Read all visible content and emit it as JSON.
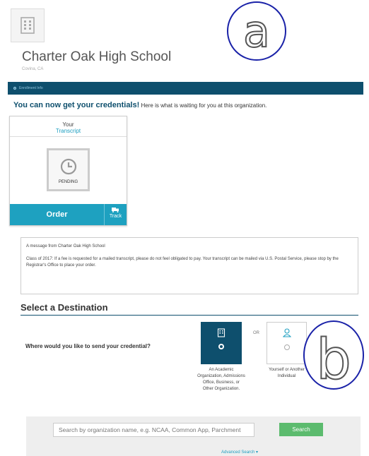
{
  "school": {
    "name": "Charter Oak High School",
    "location": "Covina, CA",
    "logo_icon": "building-icon"
  },
  "annotations": {
    "a": "a",
    "b": "b"
  },
  "enrollment_bar": {
    "label": "Enrollment Info",
    "icon": "gear-icon"
  },
  "headline": {
    "bold": "You can now get your credentials!",
    "rest": "Here is what is waiting for you at this organization."
  },
  "credential_card": {
    "your": "Your",
    "type": "Transcript",
    "status": "PENDING",
    "status_icon": "clock-icon",
    "order_label": "Order",
    "track_label": "Track",
    "track_icon": "truck-icon"
  },
  "message": {
    "title": "A message from Charter Oak High School",
    "body": "Class of 2017: If a fee is requested for a mailed transcript, please do not feel obligated to pay. Your transcript can be mailed via U.S. Postal Service, please stop by the Registrar's Office to place your order."
  },
  "destination": {
    "title": "Select a Destination",
    "question": "Where would you like to send your credential?",
    "or_label": "OR",
    "options": [
      {
        "label": "An Academic Organization, Admissions Office, Business, or Other Organization.",
        "selected": true,
        "icon": "building-icon"
      },
      {
        "label": "Yourself or Another Individual",
        "selected": false,
        "icon": "person-icon"
      }
    ]
  },
  "search": {
    "placeholder": "Search by organization name, e.g. NCAA, Common App, Parchment",
    "button_label": "Search",
    "advanced_label": "Advanced Search ▾"
  },
  "colors": {
    "navy": "#0e4f6d",
    "teal": "#1ea1c0",
    "green": "#5cbb6e",
    "annotation_blue": "#1a22a8"
  }
}
